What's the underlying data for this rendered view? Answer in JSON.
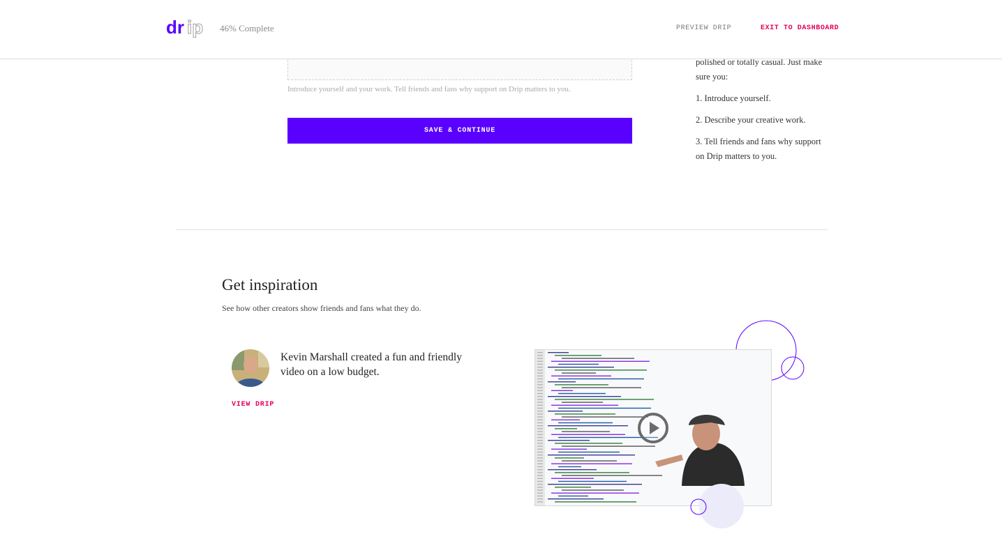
{
  "header": {
    "logo_text": "drip",
    "progress_text": "46% Complete",
    "preview_label": "PREVIEW DRIP",
    "exit_label": "EXIT TO DASHBOARD"
  },
  "form": {
    "intro_value": "",
    "hint": "Introduce yourself and your work. Tell friends and fans why support on Drip matters to you.",
    "save_label": "SAVE & CONTINUE"
  },
  "tips": {
    "intro": "polished or totally casual. Just make sure you:",
    "items": [
      "1. Introduce yourself.",
      "2. Describe your creative work.",
      "3. Tell friends and fans why support on Drip matters to you."
    ]
  },
  "inspiration": {
    "title": "Get inspiration",
    "subtitle": "See how other creators show friends and fans what they do.",
    "story": "Kevin Marshall created a fun and friendly video on a low budget.",
    "view_label": "VIEW DRIP"
  },
  "colors": {
    "brand": "#5a00ff",
    "accent": "#e4005a"
  },
  "icons": {
    "play": "play-icon",
    "avatar": "avatar"
  }
}
